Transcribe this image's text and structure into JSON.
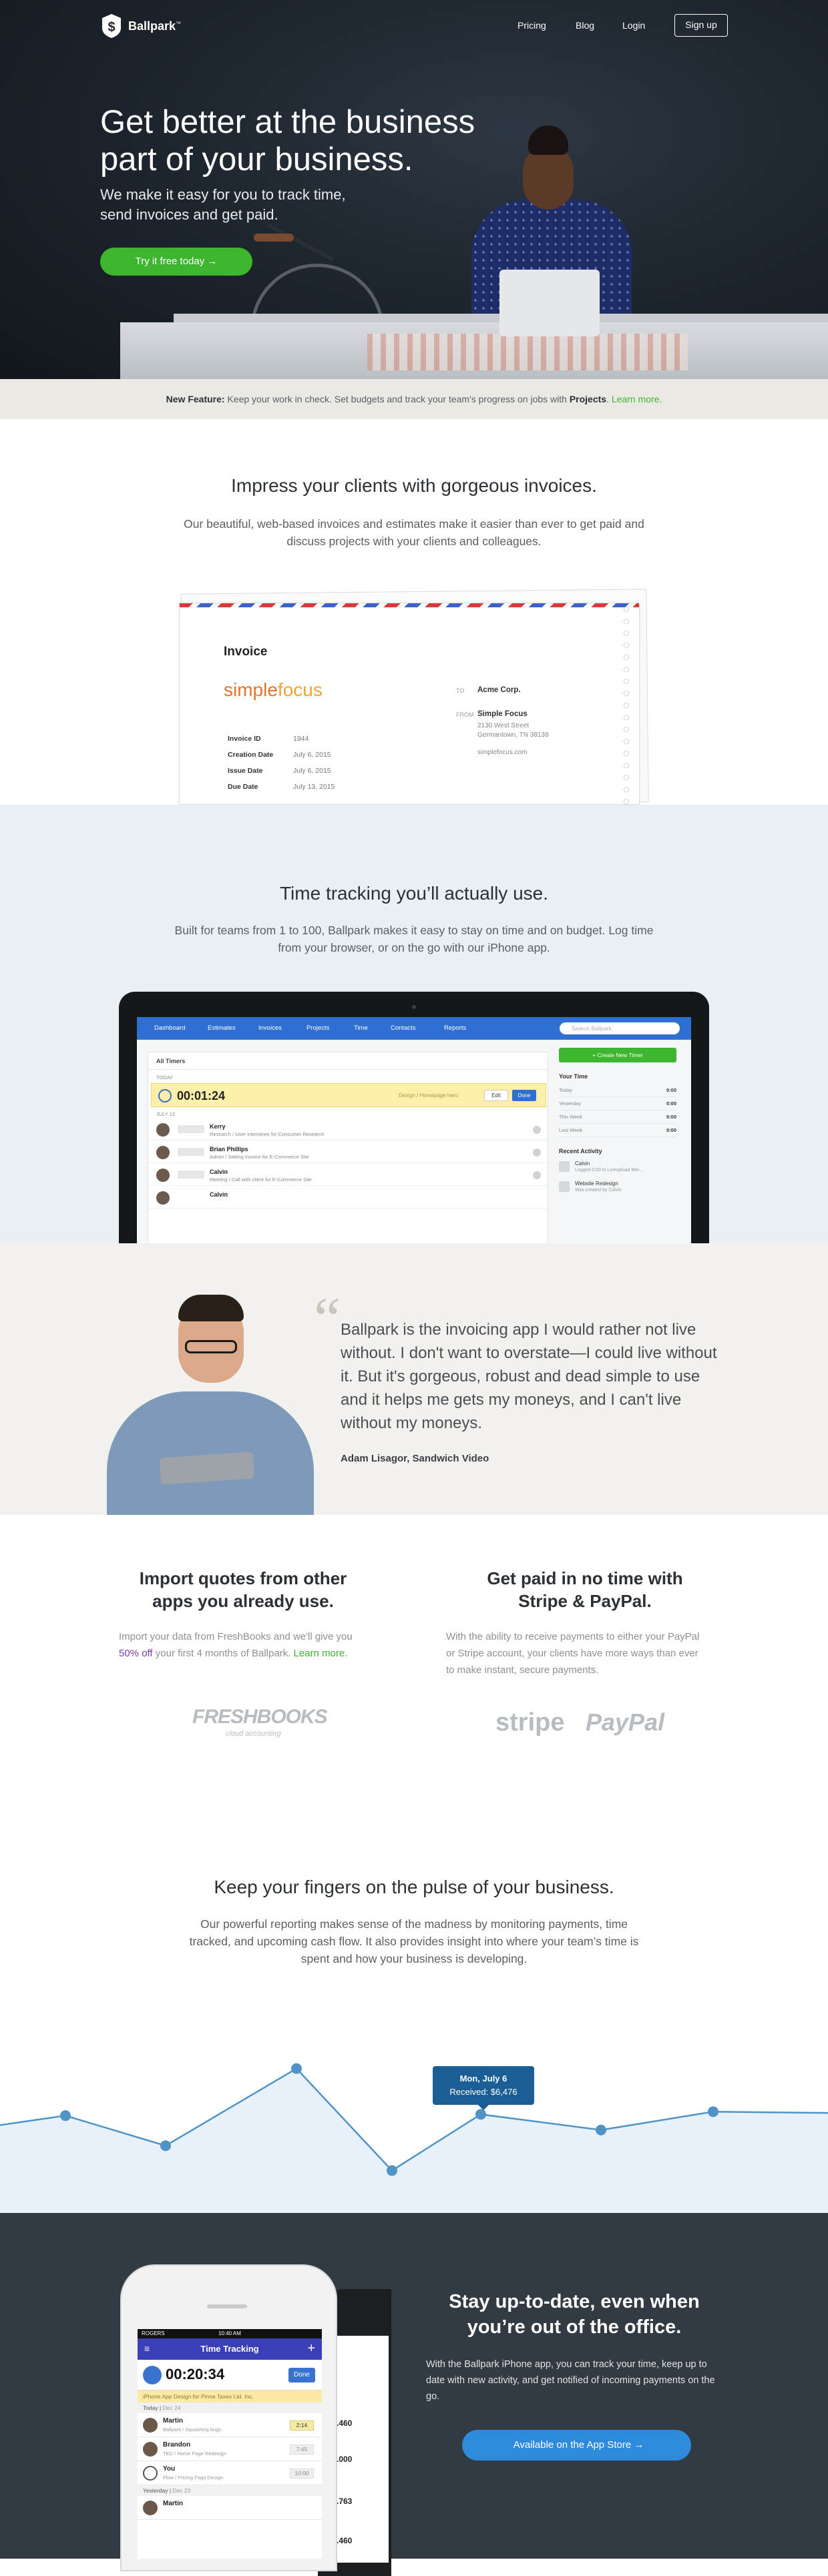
{
  "nav": {
    "logo": "Ballpark",
    "logo_mark": "™",
    "links": [
      "Pricing",
      "Blog",
      "Login"
    ],
    "signup": "Sign up"
  },
  "hero": {
    "title_line1": "Get better at the business",
    "title_line2": "part of your business.",
    "subtitle_line1": "We make it easy for you to track time,",
    "subtitle_line2": "send invoices and get paid.",
    "cta": "Try it free today →"
  },
  "feature_bar": {
    "lead": "New Feature:",
    "text": "Keep your work in check. Set budgets and track your team's progress on jobs with",
    "bold": "Projects",
    "link": "Learn more."
  },
  "invoices": {
    "heading": "Impress your clients with gorgeous invoices.",
    "lead": "Our beautiful, web-based invoices and estimates make it easier than ever to get paid and discuss projects with your clients and colleagues.",
    "doc": {
      "title": "Invoice",
      "brand_a": "simple",
      "brand_b": "focus",
      "fields": [
        {
          "label": "Invoice ID",
          "value": "1944"
        },
        {
          "label": "Creation Date",
          "value": "July 6, 2015"
        },
        {
          "label": "Issue Date",
          "value": "July 6, 2015"
        },
        {
          "label": "Due Date",
          "value": "July 13, 2015"
        }
      ],
      "to_label": "TO",
      "to": "Acme Corp.",
      "from_label": "FROM",
      "from": "Simple Focus",
      "from_addr1": "2130 West Street",
      "from_addr2": "Germantown, TN 38138",
      "from_web": "simplefocus.com"
    }
  },
  "time": {
    "heading": "Time tracking you’ll actually use.",
    "lead": "Built for teams from 1 to 100, Ballpark makes it easy to stay on time and on budget. Log time from your browser, or on the go with our iPhone app.",
    "app": {
      "nav": [
        "Dashboard",
        "Estimates",
        "Invoices",
        "Projects",
        "Time",
        "Contacts",
        "Reports"
      ],
      "search_placeholder": "Search Ballpark",
      "panel_title": "All Timers",
      "today": "TODAY",
      "yesterday": "JULY 12",
      "running_time": "00:01:24",
      "running_desc": "Design / Homepage hero",
      "edit": "Edit",
      "done": "Done",
      "rows": [
        {
          "name": "Kerry",
          "desc": "Research / User interviews for Consumer Research"
        },
        {
          "name": "Brian Phillips",
          "desc": "Admin / Setting Invoice for E-Commerce Site"
        },
        {
          "name": "Calvin",
          "desc": "Meeting / Call with client for E-Commerce Site"
        },
        {
          "name": "Calvin",
          "desc": ""
        }
      ],
      "new_timer": "+  Create New Timer",
      "your_time": "Your Time",
      "time_rows": [
        {
          "label": "Today",
          "value": "0:00"
        },
        {
          "label": "Yesterday",
          "value": "0:00"
        },
        {
          "label": "This Week",
          "value": "0:00"
        },
        {
          "label": "Last Week",
          "value": "0:00"
        }
      ],
      "recent": "Recent Activity",
      "activity": [
        {
          "title": "Calvin",
          "sub": "Logged 0:00 to Liveupload Mer..."
        },
        {
          "title": "Website Redesign",
          "sub": "Was created by Calvin"
        }
      ]
    }
  },
  "testimonial": {
    "quote": "Ballpark is the invoicing app I would rather not live without. I don't want to overstate—I could live without it. But it's gorgeous, robust and dead simple to use and it helps me gets my moneys, and I can't live without my moneys.",
    "author": "Adam Lisagor, Sandwich Video"
  },
  "import": {
    "heading_line1": "Import quotes from other",
    "heading_line2": "apps you already use.",
    "text_a": "Import your data from FreshBooks and we'll give you ",
    "text_hl": "50% off",
    "text_b": " your first 4 months of Ballpark. ",
    "text_link": "Learn more.",
    "logo": "FRESHBOOKS",
    "logo_sub": "cloud accounting"
  },
  "pay": {
    "heading_line1": "Get paid in no time with",
    "heading_line2": "Stripe & PayPal.",
    "text": "With the ability to receive payments to either your PayPal or Stripe account, your clients have more ways than ever to make instant, secure payments.",
    "logo1": "stripe",
    "logo2": "PayPal"
  },
  "reporting": {
    "heading": "Keep your fingers on the pulse of your business.",
    "lead": "Our powerful reporting makes sense of the madness by monitoring payments, time tracked, and upcoming cash flow. It also provides insight into where your team’s time is spent and how your business is developing.",
    "tooltip_date": "Mon, July 6",
    "tooltip_value": "Received: $6,476"
  },
  "chart_data": {
    "type": "area",
    "values": [
      0.46,
      0.54,
      0.31,
      0.9,
      0.12,
      0.55,
      0.43,
      0.57,
      0.56
    ],
    "color": "#4f93c7",
    "fill": "#e6f1fa"
  },
  "mobile": {
    "title_line1": "Stay up-to-date, even when",
    "title_line2": "you’re out of the office.",
    "text": "With the Ballpark iPhone app, you can track your time, keep up to date with new activity, and get notified of incoming payments on the go.",
    "cta": "Available on the App Store →",
    "phone": {
      "carrier": "ROGERS",
      "clock": "10:40 AM",
      "title": "Time Tracking",
      "timer": "00:20:34",
      "done": "Done",
      "project": "iPhone App Design for Pinne Taxes Ltd. Inc.",
      "today": "Today",
      "today_date": "Dec 24",
      "yesterday": "Yesterday",
      "yesterday_date": "Dec 23",
      "rows": [
        {
          "name": "Martin",
          "desc": "Ballpark / Squashing bugs",
          "hours": "2:14"
        },
        {
          "name": "Brandon",
          "desc": "TED / Home Page Redesign",
          "hours": "7:45"
        },
        {
          "name": "You",
          "desc": "Flow / Pricing Page Design",
          "hours": "10:00"
        },
        {
          "name": "Martin",
          "desc": "",
          "hours": ""
        }
      ],
      "back_values": [
        ".460",
        ".000",
        ".763",
        ".460"
      ]
    }
  }
}
